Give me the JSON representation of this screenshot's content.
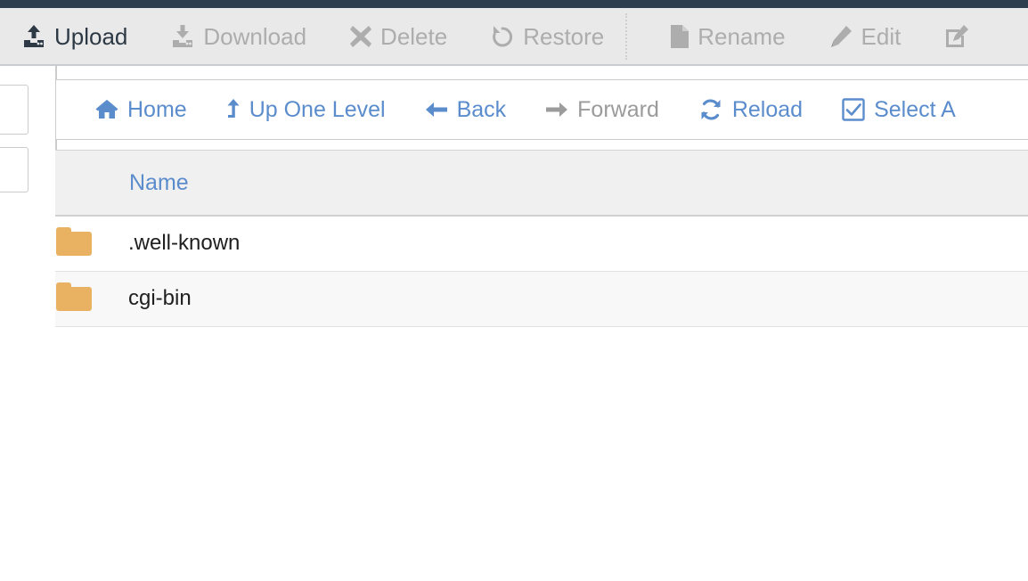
{
  "window": {
    "accent_blue": "#5b8ccc",
    "top_bar_color": "#2e3e4e",
    "toolbar_bg": "#e9e9e9",
    "folder_color": "#e8b262",
    "disabled_text": "#adadad"
  },
  "toolbar": {
    "buttons": [
      {
        "label": "Upload",
        "icon": "upload-icon",
        "enabled": true
      },
      {
        "label": "Download",
        "icon": "download-icon",
        "enabled": false
      },
      {
        "label": "Delete",
        "icon": "delete-x-icon",
        "enabled": false
      },
      {
        "label": "Restore",
        "icon": "restore-undo-icon",
        "enabled": false
      },
      {
        "label": "Rename",
        "icon": "file-icon",
        "enabled": false
      },
      {
        "label": "Edit",
        "icon": "pencil-icon",
        "enabled": false
      },
      {
        "label": "",
        "icon": "html-editor-icon",
        "enabled": false
      }
    ]
  },
  "navbar": {
    "buttons": [
      {
        "label": "Home",
        "icon": "home-icon",
        "enabled": true
      },
      {
        "label": "Up One Level",
        "icon": "up-arrow-icon",
        "enabled": true
      },
      {
        "label": "Back",
        "icon": "arrow-left-icon",
        "enabled": true
      },
      {
        "label": "Forward",
        "icon": "arrow-right-icon",
        "enabled": false
      },
      {
        "label": "Reload",
        "icon": "reload-icon",
        "enabled": true
      },
      {
        "label": "Select A",
        "icon": "checkbox-checked-icon",
        "enabled": true
      }
    ]
  },
  "file_table": {
    "columns": [
      "",
      "Name"
    ],
    "name_header": "Name",
    "rows": [
      {
        "name": ".well-known",
        "icon": "folder-icon"
      },
      {
        "name": "cgi-bin",
        "icon": "folder-icon"
      }
    ]
  }
}
